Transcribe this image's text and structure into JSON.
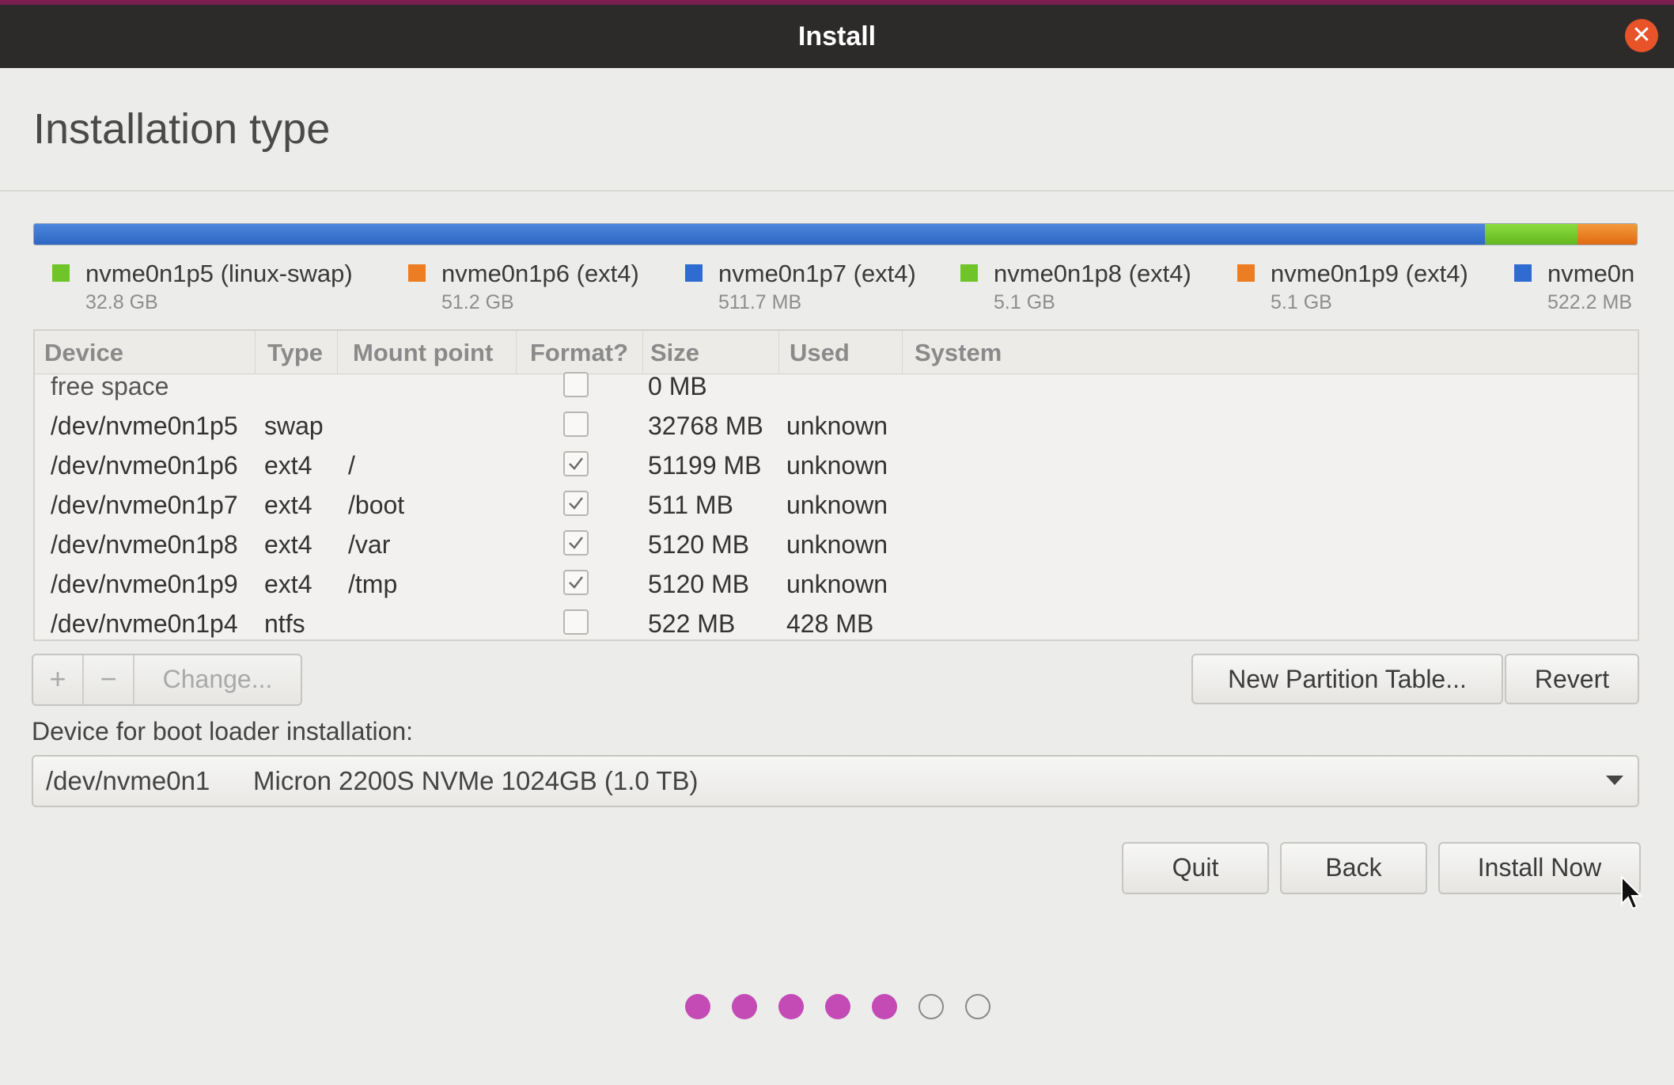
{
  "window": {
    "title": "Install",
    "close_icon": "close-icon"
  },
  "page": {
    "title": "Installation type"
  },
  "partition_bar": {
    "segments": [
      {
        "color": "#3a73d4",
        "fraction": 0.905
      },
      {
        "color": "#73c72b",
        "fraction": 0.058
      },
      {
        "color": "#ec7d22",
        "fraction": 0.037
      }
    ]
  },
  "legend": [
    {
      "name": "nvme0n1p5 (linux-swap)",
      "size": "32.8 GB",
      "color": "#6fc42a"
    },
    {
      "name": "nvme0n1p6 (ext4)",
      "size": "51.2 GB",
      "color": "#ec7d22"
    },
    {
      "name": "nvme0n1p7 (ext4)",
      "size": "511.7 MB",
      "color": "#2f6bd0"
    },
    {
      "name": "nvme0n1p8 (ext4)",
      "size": "5.1 GB",
      "color": "#6fc42a"
    },
    {
      "name": "nvme0n1p9 (ext4)",
      "size": "5.1 GB",
      "color": "#ec7d22"
    },
    {
      "name": "nvme0n",
      "size": "522.2 MB",
      "color": "#2f6bd0"
    }
  ],
  "table": {
    "headers": {
      "device": "Device",
      "type": "Type",
      "mount": "Mount point",
      "format": "Format?",
      "size": "Size",
      "used": "Used",
      "system": "System"
    },
    "rows": [
      {
        "device": "free space",
        "type": "",
        "mount": "",
        "format": false,
        "size": "0 MB",
        "used": "",
        "system": ""
      },
      {
        "device": "/dev/nvme0n1p5",
        "type": "swap",
        "mount": "",
        "format": false,
        "size": "32768 MB",
        "used": "unknown",
        "system": ""
      },
      {
        "device": "/dev/nvme0n1p6",
        "type": "ext4",
        "mount": "/",
        "format": true,
        "size": "51199 MB",
        "used": "unknown",
        "system": ""
      },
      {
        "device": "/dev/nvme0n1p7",
        "type": "ext4",
        "mount": "/boot",
        "format": true,
        "size": "511 MB",
        "used": "unknown",
        "system": ""
      },
      {
        "device": "/dev/nvme0n1p8",
        "type": "ext4",
        "mount": "/var",
        "format": true,
        "size": "5120 MB",
        "used": "unknown",
        "system": ""
      },
      {
        "device": "/dev/nvme0n1p9",
        "type": "ext4",
        "mount": "/tmp",
        "format": true,
        "size": "5120 MB",
        "used": "unknown",
        "system": ""
      },
      {
        "device": "/dev/nvme0n1p4",
        "type": "ntfs",
        "mount": "",
        "format": false,
        "size": "522 MB",
        "used": "428 MB",
        "system": ""
      }
    ]
  },
  "toolbar": {
    "add_label": "+",
    "remove_label": "−",
    "change_label": "Change...",
    "new_table_label": "New Partition Table...",
    "revert_label": "Revert"
  },
  "bootloader": {
    "label": "Device for boot loader installation:",
    "device": "/dev/nvme0n1",
    "description": "Micron 2200S NVMe 1024GB (1.0 TB)"
  },
  "actions": {
    "quit_label": "Quit",
    "back_label": "Back",
    "install_label": "Install Now"
  },
  "progress": {
    "total_steps": 7,
    "completed_steps": 5
  }
}
